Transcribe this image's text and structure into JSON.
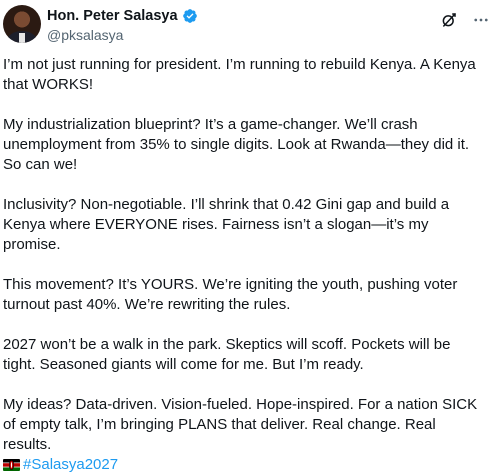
{
  "author": {
    "display_name": "Hon. Peter Salasya",
    "handle": "@pksalasya",
    "verified": true
  },
  "tweet": {
    "paragraphs": [
      "I’m not just running for president. I’m running to rebuild Kenya. A Kenya that WORKS!",
      "My industrialization blueprint? It’s a game-changer. We’ll crash unemployment from 35% to single digits. Look at Rwanda—they did it. So can we!",
      "Inclusivity? Non-negotiable. I’ll shrink that 0.42 Gini gap and build a Kenya where EVERYONE rises. Fairness isn’t a slogan—it’s my promise.",
      "This movement? It’s YOURS. We’re igniting the youth, pushing voter turnout past 40%. We’re rewriting the rules.",
      "2027 won’t be a walk in the park. Skeptics will scoff. Pockets will be tight. Seasoned giants will come for me. But I’m ready.",
      "My ideas? Data-driven. Vision-fueled. Hope-inspired. For a nation SICK of empty talk, I’m bringing PLANS that deliver. Real change. Real results."
    ],
    "hashtag": "#Salasya2027"
  },
  "icons": {
    "verified": "verified-badge-icon",
    "grok": "grok-icon",
    "more": "more-options-icon",
    "flag": "kenya-flag-icon"
  },
  "colors": {
    "text": "#0f1419",
    "secondary": "#536471",
    "link": "#1d9bf0",
    "verified": "#1d9bf0"
  }
}
